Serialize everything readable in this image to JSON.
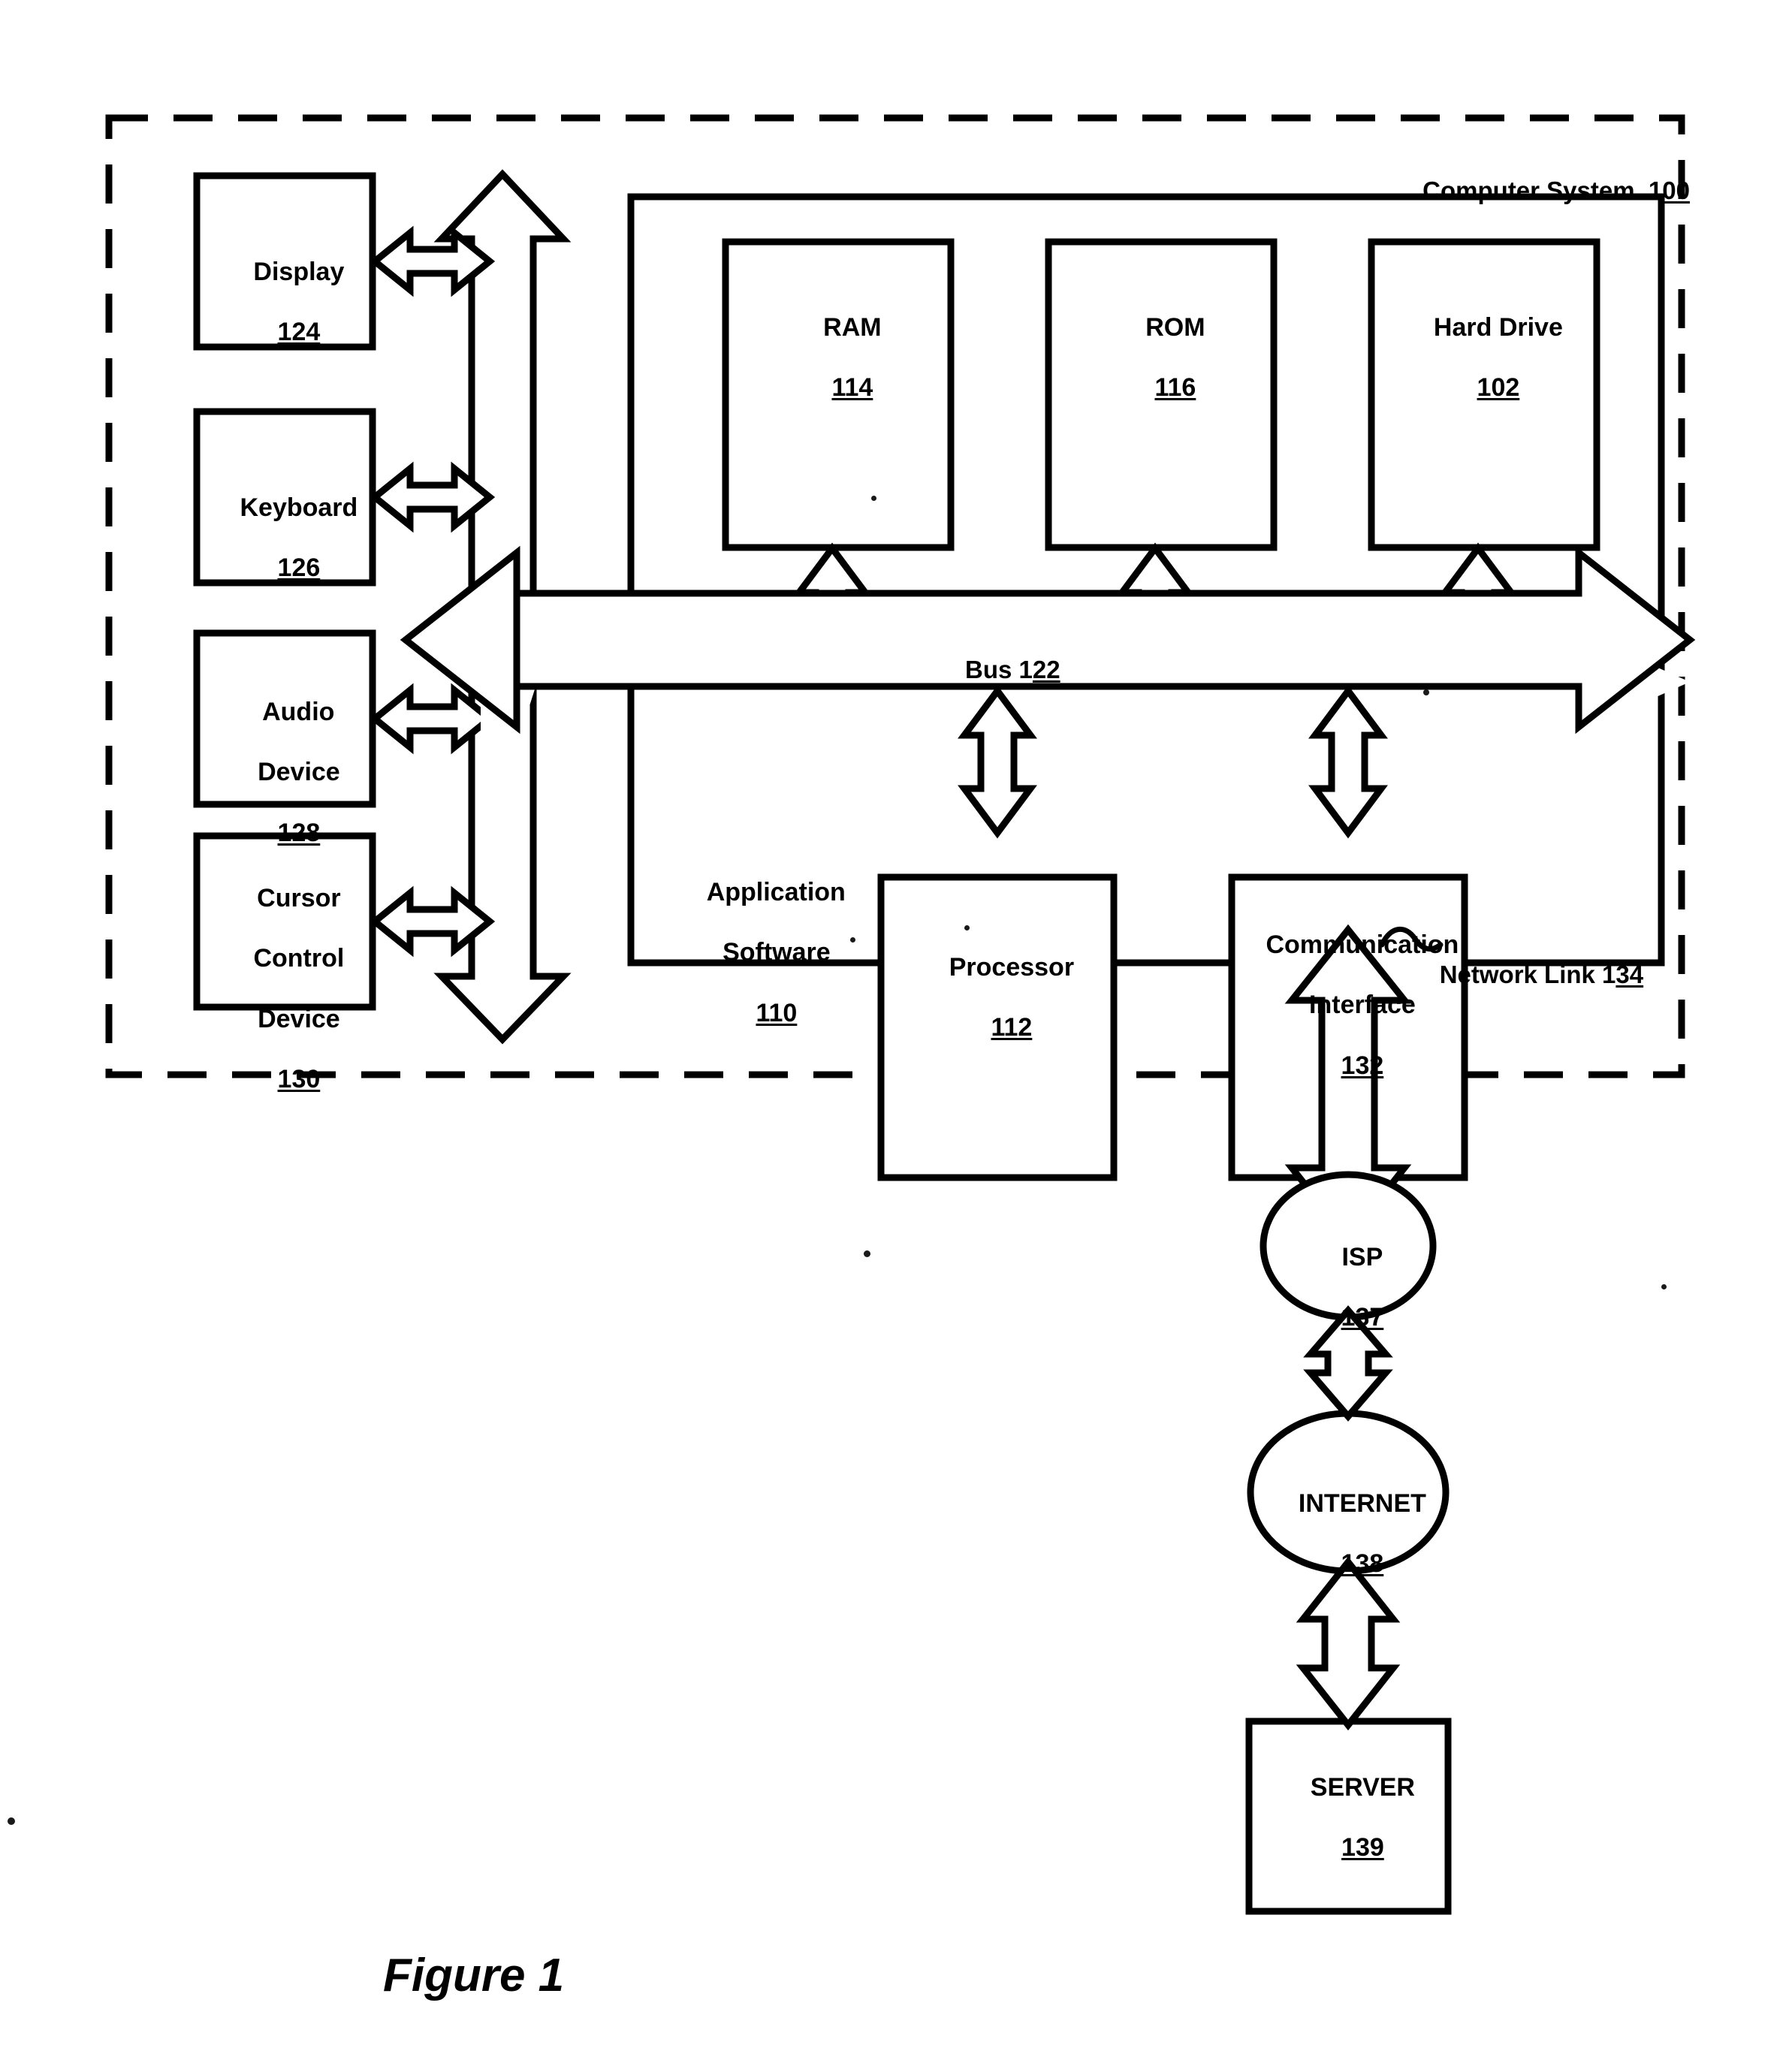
{
  "figure": {
    "caption": "Figure 1",
    "system_label_text": "Computer System",
    "system_label_number_prefix": "1",
    "system_label_number_underlined": "00",
    "bus_label_text": "Bus 1",
    "bus_label_number_underlined": "22",
    "network_link_text": "Network Link 1",
    "network_link_number_underlined": "34",
    "app_software_line1": "Application",
    "app_software_line2": "Software",
    "app_software_number": "110"
  },
  "peripherals": [
    {
      "name": "display",
      "lines": [
        "Display"
      ],
      "number": "124"
    },
    {
      "name": "keyboard",
      "lines": [
        "Keyboard"
      ],
      "number": "126"
    },
    {
      "name": "audio-device",
      "lines": [
        "Audio",
        "Device"
      ],
      "number": "128"
    },
    {
      "name": "cursor-control-device",
      "lines": [
        "Cursor",
        "Control",
        "Device"
      ],
      "number": "130"
    }
  ],
  "memory_blocks": [
    {
      "name": "ram",
      "lines": [
        "RAM"
      ],
      "number": "114"
    },
    {
      "name": "rom",
      "lines": [
        "ROM"
      ],
      "number": "116"
    },
    {
      "name": "hard-drive",
      "lines": [
        "Hard Drive"
      ],
      "number": "102"
    }
  ],
  "core_blocks": [
    {
      "name": "processor",
      "lines": [
        "Processor"
      ],
      "number": "112"
    },
    {
      "name": "communication-interface",
      "lines": [
        "Communication",
        "Interface"
      ],
      "number": "132"
    }
  ],
  "network_nodes": [
    {
      "name": "isp",
      "shape": "ellipse",
      "lines": [
        "ISP"
      ],
      "number": "137"
    },
    {
      "name": "internet",
      "shape": "ellipse",
      "lines": [
        "INTERNET"
      ],
      "number": "138"
    },
    {
      "name": "server",
      "shape": "rect",
      "lines": [
        "SERVER"
      ],
      "number": "139"
    }
  ],
  "colors": {
    "ink": "#000000",
    "paper": "#ffffff"
  }
}
